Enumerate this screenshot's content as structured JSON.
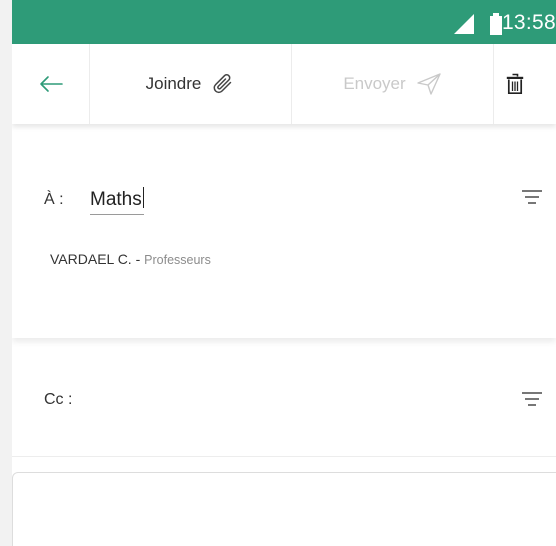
{
  "status_bar": {
    "time": "13:58",
    "signal_icon": "signal-icon",
    "battery_icon": "battery-icon",
    "background_color": "#2e9b78"
  },
  "toolbar": {
    "back_icon": "arrow-left-icon",
    "attach_label": "Joindre",
    "attach_icon": "paperclip-icon",
    "send_label": "Envoyer",
    "send_icon": "send-icon",
    "delete_icon": "trash-icon",
    "accent_color": "#2e9b78",
    "disabled_color": "#c9c9c9"
  },
  "recipients": {
    "to_label": "À :",
    "to_value": "Maths",
    "filter_icon": "filter-icon",
    "suggestion": {
      "name": "VARDAEL C. -",
      "role": "Professeurs"
    }
  },
  "cc": {
    "label": "Cc :",
    "filter_icon": "filter-icon"
  }
}
